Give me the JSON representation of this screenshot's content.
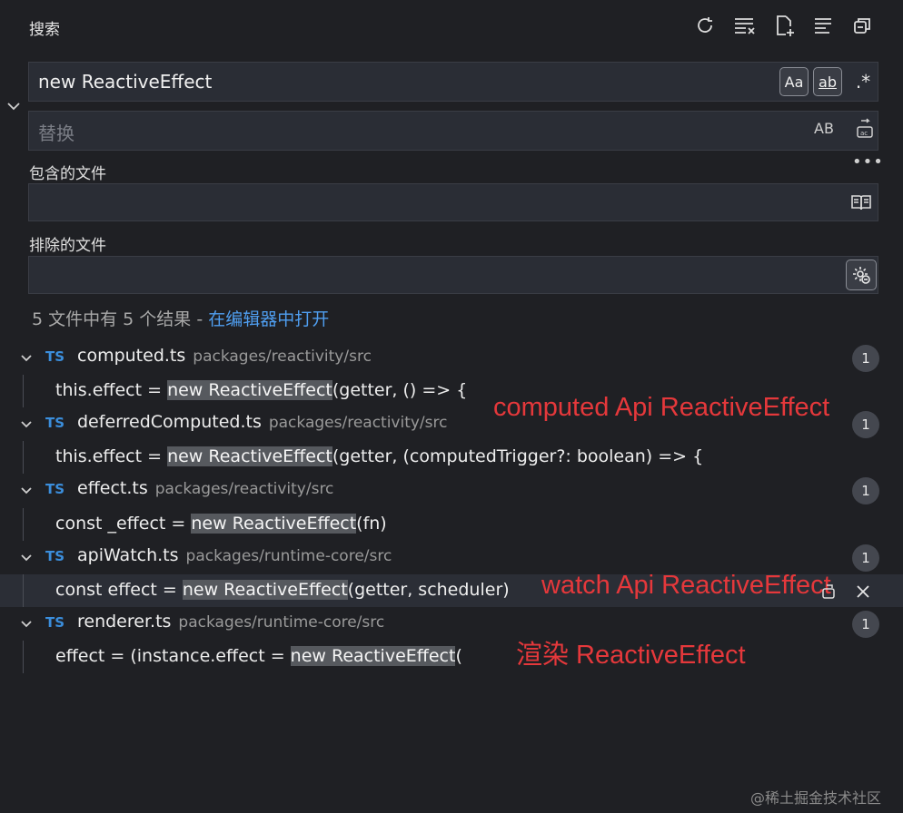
{
  "header": {
    "title": "搜索",
    "icons": [
      "refresh-icon",
      "clear-results-icon",
      "new-search-editor-icon",
      "view-as-tree-icon",
      "collapse-all-icon"
    ]
  },
  "search": {
    "value": "new ReactiveEffect",
    "match_case_label": "Aa",
    "whole_word_label": "ab",
    "regex_label": ".*"
  },
  "replace": {
    "placeholder": "替换",
    "preserve_case_label": "AB"
  },
  "include": {
    "label": "包含的文件",
    "value": ""
  },
  "exclude": {
    "label": "排除的文件",
    "value": ""
  },
  "summary": {
    "text": "5 文件中有 5 个结果 - ",
    "link": "在编辑器中打开"
  },
  "results": [
    {
      "lang": "TS",
      "file": "computed.ts",
      "path": "packages/reactivity/src",
      "count": "1",
      "pre": "this.effect = ",
      "match": "new ReactiveEffect",
      "post": "(getter, () => {"
    },
    {
      "lang": "TS",
      "file": "deferredComputed.ts",
      "path": "packages/reactivity/src",
      "count": "1",
      "pre": "this.effect = ",
      "match": "new ReactiveEffect",
      "post": "(getter, (computedTrigger?: boolean) => {"
    },
    {
      "lang": "TS",
      "file": "effect.ts",
      "path": "packages/reactivity/src",
      "count": "1",
      "pre": "const _effect = ",
      "match": "new ReactiveEffect",
      "post": "(fn)"
    },
    {
      "lang": "TS",
      "file": "apiWatch.ts",
      "path": "packages/runtime-core/src",
      "count": "1",
      "pre": "const effect = ",
      "match": "new ReactiveEffect",
      "post": "(getter, scheduler)"
    },
    {
      "lang": "TS",
      "file": "renderer.ts",
      "path": "packages/runtime-core/src",
      "count": "1",
      "pre": "effect = (instance.effect = ",
      "match": "new ReactiveEffect",
      "post": "("
    }
  ],
  "annotations": {
    "computed": "computed Api ReactiveEffect",
    "watch": "watch Api ReactiveEffect",
    "render": "渲染 ReactiveEffect"
  },
  "watermark": "@稀土掘金技术社区",
  "colors": {
    "background": "#1f2024",
    "input": "#2a2d35",
    "link": "#4f9ef0",
    "ts_badge": "#3b8edc",
    "match_highlight": "#56595e",
    "annotation": "#e5383b"
  }
}
